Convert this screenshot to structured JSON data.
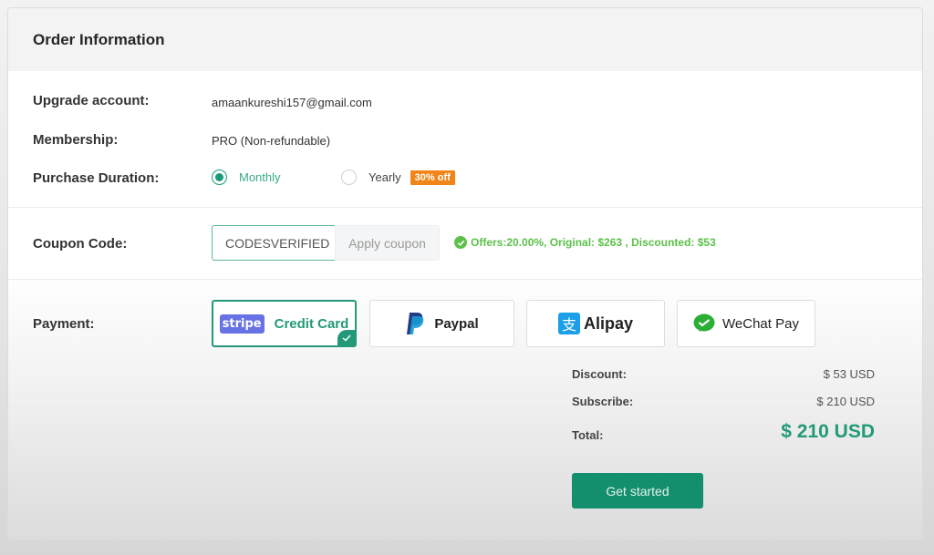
{
  "header": {
    "title": "Order Information"
  },
  "account": {
    "upgrade_label": "Upgrade account:",
    "upgrade_value": "amaankureshi157@gmail.com",
    "membership_label": "Membership:",
    "membership_value": "PRO (Non-refundable)",
    "duration_label": "Purchase Duration:",
    "duration_options": [
      {
        "label": "Monthly",
        "selected": true
      },
      {
        "label": "Yearly",
        "selected": false,
        "badge": "30% off"
      }
    ]
  },
  "coupon": {
    "label": "Coupon Code:",
    "value": "CODESVERIFIED",
    "apply_label": "Apply coupon",
    "status_text": "Offers:20.00%, Original: $263 , Discounted: $53"
  },
  "payment": {
    "label": "Payment:",
    "options": [
      {
        "id": "stripe",
        "logo_text": "stripe",
        "label": "Credit Card",
        "selected": true
      },
      {
        "id": "paypal",
        "label": "Paypal",
        "selected": false
      },
      {
        "id": "alipay",
        "logo_text": "支",
        "label": "Alipay",
        "selected": false
      },
      {
        "id": "wechat",
        "label": "WeChat Pay",
        "selected": false
      }
    ]
  },
  "summary": {
    "discount_label": "Discount:",
    "discount_value": "$ 53 USD",
    "subscribe_label": "Subscribe:",
    "subscribe_value": "$ 210 USD",
    "total_label": "Total:",
    "total_value": "$ 210 USD"
  },
  "cta": {
    "label": "Get started"
  },
  "colors": {
    "accent": "#199b7a",
    "badge": "#f08519",
    "success": "#5cc04a",
    "stripe": "#6772e5"
  }
}
